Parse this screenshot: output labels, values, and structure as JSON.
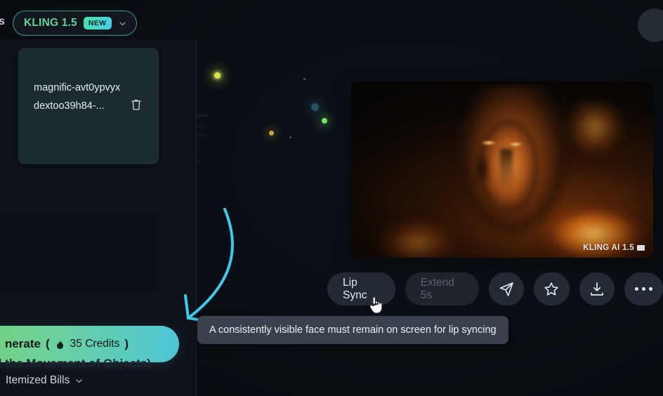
{
  "model_selector": {
    "name": "KLING 1.5",
    "badge": "NEW",
    "chevron_icon": "chevron-down-icon"
  },
  "edge_label": "s",
  "left_panel": {
    "file_card": {
      "filename": "magnific-avt0ypvyxdextoo39h84-...",
      "delete_icon": "trash-icon"
    },
    "generate_button": {
      "label": "nerate",
      "credits": "35 Credits",
      "credits_prefix": "(",
      "credits_suffix": ")",
      "flame_icon": "flame-icon"
    },
    "subtitle_dim": "Control the Movement of Objects)",
    "itemized_bills": {
      "label": "Itemized Bills",
      "chevron_icon": "chevron-down-icon"
    }
  },
  "video_card": {
    "watermark": "KLING AI 1.5",
    "watermark_badge_icon": "hd-badge-icon"
  },
  "actions": [
    {
      "label": "Lip Sync",
      "name": "lip-sync-button",
      "type": "pill",
      "state": "active"
    },
    {
      "label": "Extend 5s",
      "name": "extend-5s-button",
      "type": "pill",
      "state": "disabled"
    },
    {
      "label": "",
      "name": "share-button",
      "type": "icon",
      "icon": "send-icon"
    },
    {
      "label": "",
      "name": "favorite-button",
      "type": "icon",
      "icon": "star-icon"
    },
    {
      "label": "",
      "name": "download-button",
      "type": "icon",
      "icon": "download-icon"
    },
    {
      "label": "",
      "name": "more-button",
      "type": "more",
      "icon": "ellipsis-icon"
    }
  ],
  "tooltip": {
    "text": "A consistently visible face must remain on screen for lip syncing"
  },
  "annotation": {
    "arrow_icon": "curved-arrow-icon",
    "color": "#3fc9e8"
  },
  "cursor": {
    "icon": "pointing-hand-cursor"
  },
  "colors": {
    "accent_green": "#5fd39a",
    "accent_cyan": "#46cfe6",
    "generate_gradient_start": "#74cf6f",
    "generate_gradient_end": "#4ec6d8",
    "panel_bg": "#0e1219",
    "card_bg": "#1b2b2f",
    "button_bg": "#242a33",
    "tooltip_bg": "#3a414c"
  }
}
